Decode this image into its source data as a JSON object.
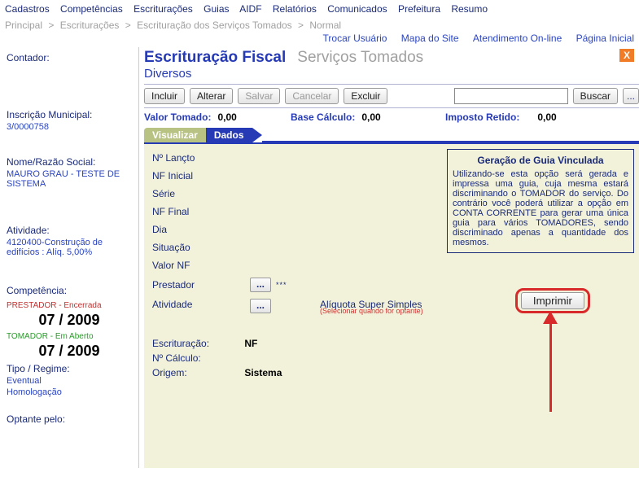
{
  "menu": {
    "items": [
      "Cadastros",
      "Competências",
      "Escriturações",
      "Guias",
      "AIDF",
      "Relatórios",
      "Comunicados",
      "Prefeitura",
      "Resumo"
    ]
  },
  "breadcrumb": {
    "items": [
      "Principal",
      ">",
      "Escriturações",
      ">",
      "Escrituração dos Serviços Tomados",
      ">",
      "Normal"
    ]
  },
  "sublinks": {
    "items": [
      "Trocar Usuário",
      "Mapa do Site",
      "Atendimento On-line",
      "Página Inicial"
    ]
  },
  "sidebar": {
    "contador_label": "Contador:",
    "insc_label": "Inscrição Municipal:",
    "insc_val": "3/0000758",
    "nome_label": "Nome/Razão Social:",
    "nome_val": "MAURO GRAU - TESTE DE SISTEMA",
    "atividade_label": "Atividade:",
    "atividade_val": "4120400-Construção de edifícios : Alíq. 5,00%",
    "comp_label": "Competência:",
    "comp_prest": "PRESTADOR - Encerrada",
    "comp_period1": "07 / 2009",
    "comp_tom": "TOMADOR - Em Aberto",
    "comp_period2": "07 / 2009",
    "tipo_label": "Tipo / Regime:",
    "tipo_val1": "Eventual",
    "tipo_val2": "Homologação",
    "optante_label": "Optante pelo:"
  },
  "header": {
    "title": "Escrituração Fiscal",
    "subtitle": "Serviços Tomados",
    "subhead": "Diversos",
    "close": "X"
  },
  "actions": {
    "incluir": "Incluir",
    "alterar": "Alterar",
    "salvar": "Salvar",
    "cancelar": "Cancelar",
    "excluir": "Excluir",
    "buscar": "Buscar",
    "more": "..."
  },
  "totals": {
    "val_tomado_lbl": "Valor Tomado:",
    "val_tomado": "0,00",
    "base_lbl": "Base Cálculo:",
    "base": "0,00",
    "imposto_lbl": "Imposto Retido:",
    "imposto": "0,00"
  },
  "tabs": {
    "visualizar": "Visualizar",
    "dados": "Dados"
  },
  "form": {
    "labels": {
      "lancto": "Nº Lançto",
      "nf_inicial": "NF Inicial",
      "serie": "Série",
      "nf_final": "NF Final",
      "dia": "Dia",
      "situacao": "Situação",
      "valor_nf": "Valor NF",
      "prestador": "Prestador",
      "atividade": "Atividade"
    },
    "pick": "...",
    "asterisks": "***",
    "aliquota_label": "Alíquota Super Simples",
    "aliquota_note": "(Selecionar quando for optante)",
    "ground": {
      "escr_lbl": "Escrituração:",
      "escr_val": "NF",
      "calc_lbl": "Nº Cálculo:",
      "origem_lbl": "Origem:",
      "origem_val": "Sistema"
    }
  },
  "guide": {
    "title": "Geração de Guia Vinculada",
    "body": "Utilizando-se esta opção será gerada e impressa uma guia, cuja mesma estará discriminando o TOMADOR do serviço. Do contrário você poderá utilizar a opção em CONTA CORRENTE para gerar uma única guia para vários TOMADORES, sendo discriminado apenas a quantidade dos mesmos.",
    "print": "Imprimir"
  }
}
